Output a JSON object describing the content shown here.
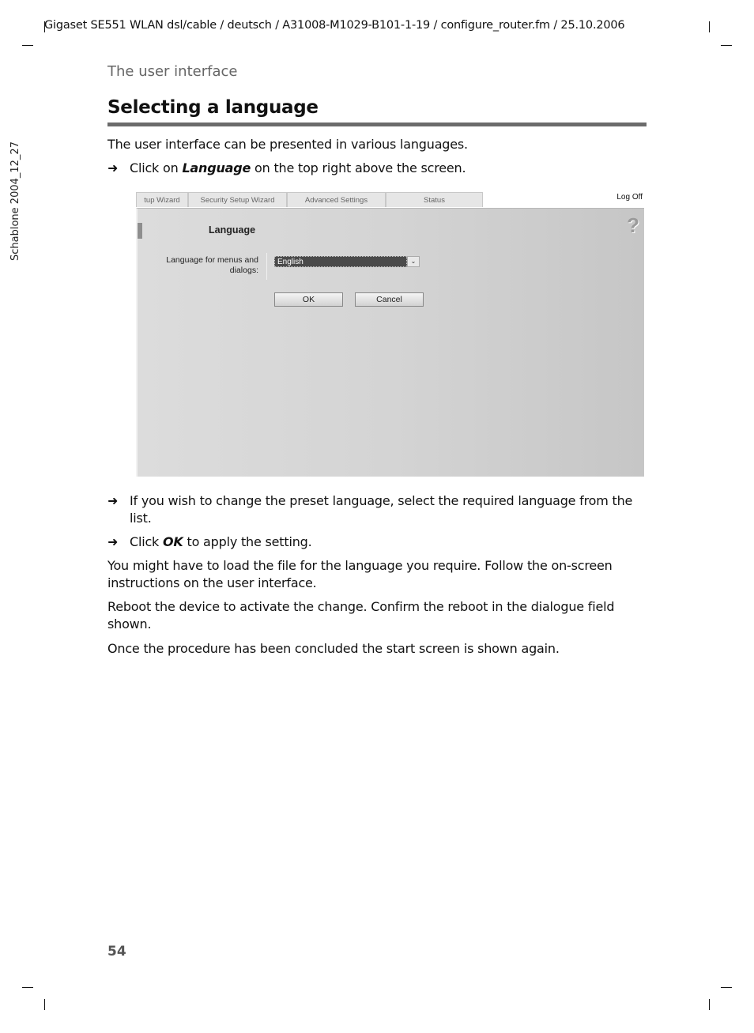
{
  "header": {
    "running_head": "Gigaset SE551 WLAN dsl/cable / deutsch / A31008-M1029-B101-1-19 / configure_router.fm / 25.10.2006",
    "section": "The user interface",
    "side_note": "Schablone 2004_12_27"
  },
  "content": {
    "title": "Selecting a language",
    "intro": "The user interface can be presented in various languages.",
    "arrow_glyph": "➜",
    "step1": {
      "pre": "Click on ",
      "em": "Language",
      "post": " on the top right above the screen."
    },
    "step2": "If you wish to change the preset language, select the required language from the list.",
    "step3": {
      "pre": "Click ",
      "em": "OK",
      "post": " to apply the setting."
    },
    "para1": "You might have to load the file for the language you require. Follow the on-screen instructions on the user interface.",
    "para2": "Reboot the device to activate the change. Confirm the reboot in the dialogue field shown.",
    "para3": "Once the procedure has been concluded the start screen is shown again."
  },
  "screenshot": {
    "tabs": [
      "tup Wizard",
      "Security Setup Wizard",
      "Advanced Settings",
      "Status"
    ],
    "log_off": "Log Off",
    "help_icon": "?",
    "panel_title": "Language",
    "field_label": "Language for menus and dialogs:",
    "select_value": "English",
    "select_arrow": "⌄",
    "ok": "OK",
    "cancel": "Cancel"
  },
  "footer": {
    "page_number": "54"
  }
}
